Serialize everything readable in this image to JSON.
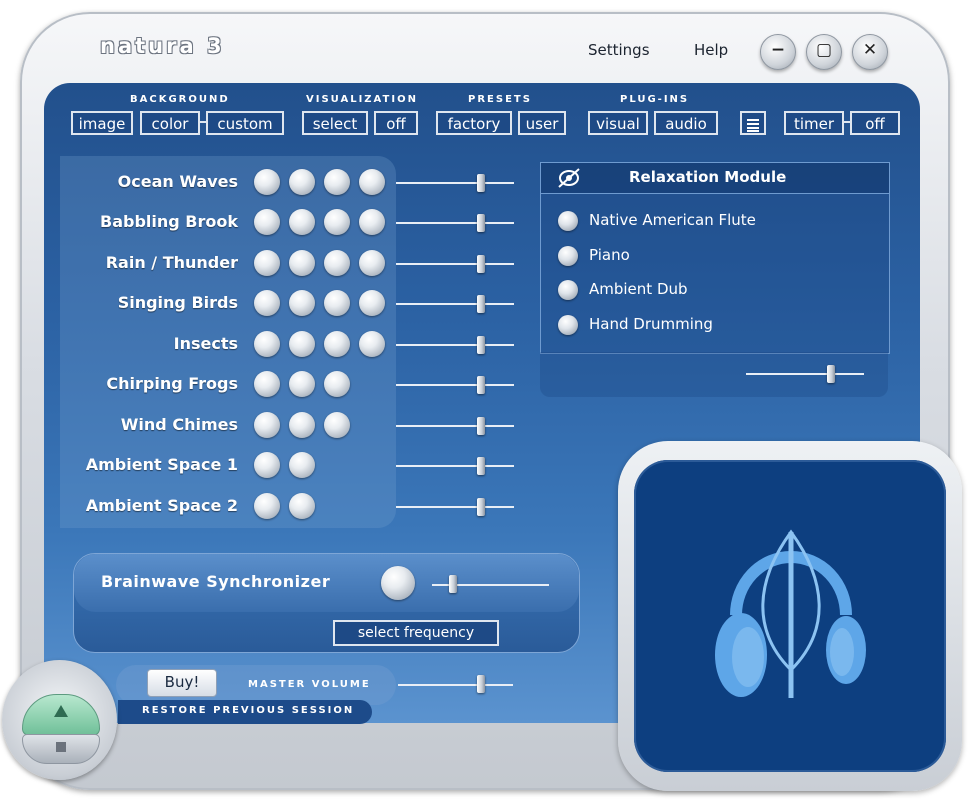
{
  "app": {
    "logo": "natura 3",
    "menu": {
      "settings": "Settings",
      "help": "Help"
    },
    "window_buttons": {
      "minimize": "−",
      "maximize": "▢",
      "close": "✕"
    }
  },
  "toolbar": {
    "background": {
      "label": "BACKGROUND",
      "buttons": [
        "image",
        "color",
        "custom"
      ]
    },
    "visualization": {
      "label": "VISUALIZATION",
      "buttons": [
        "select",
        "off"
      ]
    },
    "presets": {
      "label": "PRESETS",
      "buttons": [
        "factory",
        "user"
      ]
    },
    "plugins": {
      "label": "PLUG-INS",
      "buttons": [
        "visual",
        "audio"
      ]
    },
    "list_icon": "list-icon",
    "timer": {
      "label": "timer",
      "value": "off"
    }
  },
  "sounds": [
    {
      "name": "Ocean Waves",
      "knobs": 4,
      "volume": 0.72
    },
    {
      "name": "Babbling Brook",
      "knobs": 4,
      "volume": 0.72
    },
    {
      "name": "Rain / Thunder",
      "knobs": 4,
      "volume": 0.72
    },
    {
      "name": "Singing Birds",
      "knobs": 4,
      "volume": 0.72
    },
    {
      "name": "Insects",
      "knobs": 4,
      "volume": 0.72
    },
    {
      "name": "Chirping Frogs",
      "knobs": 3,
      "volume": 0.72
    },
    {
      "name": "Wind Chimes",
      "knobs": 3,
      "volume": 0.72
    },
    {
      "name": "Ambient Space 1",
      "knobs": 2,
      "volume": 0.72
    },
    {
      "name": "Ambient Space 2",
      "knobs": 2,
      "volume": 0.72
    }
  ],
  "relaxation": {
    "title": "Relaxation Module",
    "items": [
      "Native American Flute",
      "Piano",
      "Ambient Dub",
      "Hand Drumming"
    ],
    "volume": 0.72
  },
  "brainwave": {
    "title": "Brainwave Synchronizer",
    "select_label": "select frequency",
    "level": 0.18
  },
  "footer": {
    "buy": "Buy!",
    "master_volume": "MASTER VOLUME",
    "master_level": 0.72,
    "restore": "RESTORE PREVIOUS SESSION"
  },
  "colors": {
    "panel": "#2b61a3",
    "accent": "#0d3f80",
    "play": "#6fbf98"
  }
}
